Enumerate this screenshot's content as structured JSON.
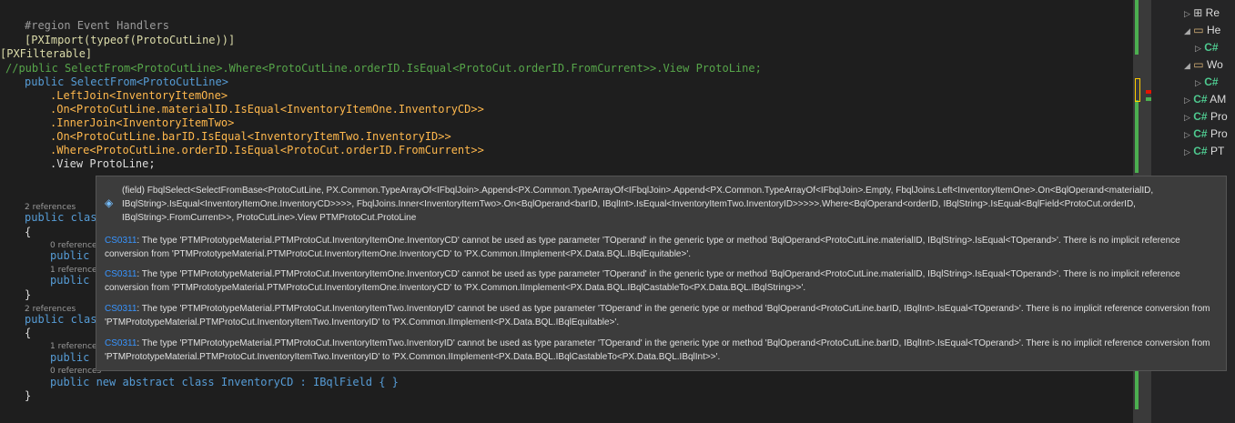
{
  "editor": {
    "lines": [
      {
        "text": "#region Event Handlers"
      },
      {
        "text": "[PXImport(typeof(ProtoCutLine))]"
      },
      {
        "text": "[PXFilterable]"
      },
      {
        "text": "//public SelectFrom<ProtoCutLine>.Where<ProtoCutLine.orderID.IsEqual<ProtoCut.orderID.FromCurrent>>.View ProtoLine;"
      },
      {
        "text": "public SelectFrom<ProtoCutLine>"
      },
      {
        "text": ".LeftJoin<InventoryItemOne>"
      },
      {
        "text": ".On<ProtoCutLine.materialID.IsEqual<InventoryItemOne.InventoryCD>>"
      },
      {
        "text": ".InnerJoin<InventoryItemTwo>"
      },
      {
        "text": ".On<ProtoCutLine.barID.IsEqual<InventoryItemTwo.InventoryID>>"
      },
      {
        "text": ".Where<ProtoCutLine.orderID.IsEqual<ProtoCut.orderID.FromCurrent>>"
      },
      {
        "text": ".View ProtoLine;"
      },
      {
        "text": "public clas"
      },
      {
        "text": "{"
      },
      {
        "text": "public"
      },
      {
        "text": "public"
      },
      {
        "text": "}"
      },
      {
        "text": "public clas"
      },
      {
        "text": "{"
      },
      {
        "text": "public"
      },
      {
        "text": "public new abstract class InventoryCD : IBqlField { }"
      },
      {
        "text": "}"
      }
    ],
    "refs": [
      "2 references",
      "0 references",
      "1 reference",
      "2 references",
      "1 reference",
      "0 references"
    ]
  },
  "tooltip": {
    "signature": "(field) FbqlSelect<SelectFromBase<ProtoCutLine, PX.Common.TypeArrayOf<IFbqlJoin>.Append<PX.Common.TypeArrayOf<IFbqlJoin>.Append<PX.Common.TypeArrayOf<IFbqlJoin>.Empty, FbqlJoins.Left<InventoryItemOne>.On<BqlOperand<materialID, IBqlString>.IsEqual<InventoryItemOne.InventoryCD>>>>, FbqlJoins.Inner<InventoryItemTwo>.On<BqlOperand<barID, IBqlInt>.IsEqual<InventoryItemTwo.InventoryID>>>>>.Where<BqlOperand<orderID, IBqlString>.IsEqual<BqlField<ProtoCut.orderID, IBqlString>.FromCurrent>>, ProtoCutLine>.View PTMProtoCut.ProtoLine",
    "errors": [
      {
        "code": "CS0311",
        "message": ": The type 'PTMPrototypeMaterial.PTMProtoCut.InventoryItemOne.InventoryCD' cannot be used as type parameter 'TOperand' in the generic type or method 'BqlOperand<ProtoCutLine.materialID, IBqlString>.IsEqual<TOperand>'. There is no implicit reference conversion from 'PTMPrototypeMaterial.PTMProtoCut.InventoryItemOne.InventoryCD' to 'PX.Common.IImplement<PX.Data.BQL.IBqlEquitable>'."
      },
      {
        "code": "CS0311",
        "message": ": The type 'PTMPrototypeMaterial.PTMProtoCut.InventoryItemOne.InventoryCD' cannot be used as type parameter 'TOperand' in the generic type or method 'BqlOperand<ProtoCutLine.materialID, IBqlString>.IsEqual<TOperand>'. There is no implicit reference conversion from 'PTMPrototypeMaterial.PTMProtoCut.InventoryItemOne.InventoryCD' to 'PX.Common.IImplement<PX.Data.BQL.IBqlCastableTo<PX.Data.BQL.IBqlString>>'."
      },
      {
        "code": "CS0311",
        "message": ": The type 'PTMPrototypeMaterial.PTMProtoCut.InventoryItemTwo.InventoryID' cannot be used as type parameter 'TOperand' in the generic type or method 'BqlOperand<ProtoCutLine.barID, IBqlInt>.IsEqual<TOperand>'. There is no implicit reference conversion from 'PTMPrototypeMaterial.PTMProtoCut.InventoryItemTwo.InventoryID' to 'PX.Common.IImplement<PX.Data.BQL.IBqlEquitable>'."
      },
      {
        "code": "CS0311",
        "message": ": The type 'PTMPrototypeMaterial.PTMProtoCut.InventoryItemTwo.InventoryID' cannot be used as type parameter 'TOperand' in the generic type or method 'BqlOperand<ProtoCutLine.barID, IBqlInt>.IsEqual<TOperand>'. There is no implicit reference conversion from 'PTMPrototypeMaterial.PTMProtoCut.InventoryItemTwo.InventoryID' to 'PX.Common.IImplement<PX.Data.BQL.IBqlCastableTo<PX.Data.BQL.IBqlInt>>'."
      }
    ]
  },
  "solution": {
    "items": [
      {
        "icon": "references-icon",
        "label": "Re"
      },
      {
        "icon": "folder-icon",
        "label": "He"
      },
      {
        "icon": "csharp-file-icon",
        "label": "C#"
      },
      {
        "icon": "folder-icon",
        "label": "Wo"
      },
      {
        "icon": "csharp-file-icon",
        "label": "C#"
      },
      {
        "icon": "csharp-file-icon",
        "label": "AM"
      },
      {
        "icon": "csharp-file-icon",
        "label": "Pro"
      },
      {
        "icon": "csharp-file-icon",
        "label": "Pro"
      },
      {
        "icon": "csharp-file-icon",
        "label": "PT"
      }
    ]
  },
  "colors": {
    "background": "#1e1e1e",
    "tooltip": "#3c3c3c",
    "error_code": "#3794ff",
    "keyword": "#569cd6",
    "type": "#ffb84d"
  }
}
